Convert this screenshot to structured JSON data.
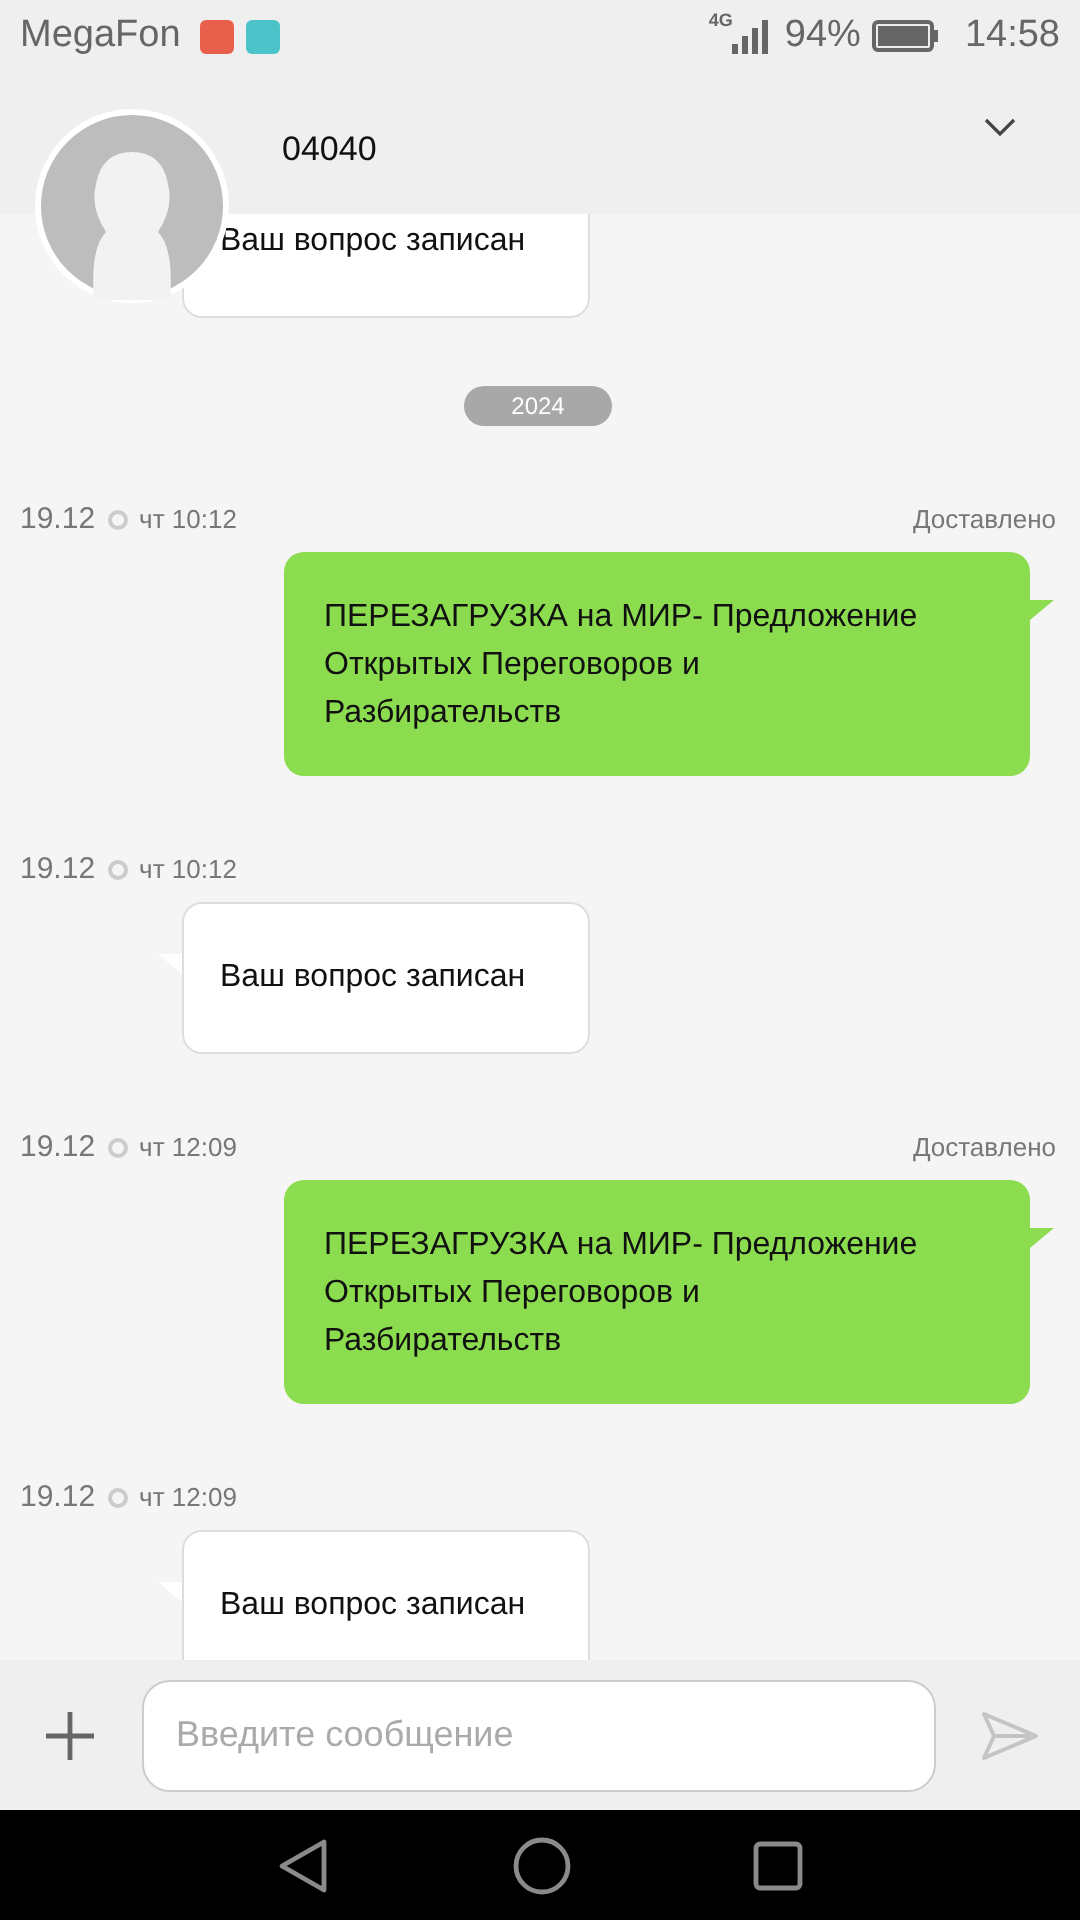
{
  "status_bar": {
    "carrier": "MegaFon",
    "network": "4G",
    "battery": "94%",
    "time": "14:58"
  },
  "header": {
    "contact": "04040"
  },
  "messages": [
    {
      "kind": "incoming",
      "text": "Ваш вопрос записан"
    },
    {
      "kind": "divider",
      "text": "2024"
    },
    {
      "kind": "outgoing",
      "date": "19.12",
      "time": "чт 10:12",
      "status": "Доставлено",
      "text": "ПЕРЕЗАГРУЗКА на МИР- Предложение Открытых Переговоров и Разбирательств"
    },
    {
      "kind": "incoming",
      "date": "19.12",
      "time": "чт 10:12",
      "text": "Ваш вопрос записан"
    },
    {
      "kind": "outgoing",
      "date": "19.12",
      "time": "чт 12:09",
      "status": "Доставлено",
      "text": "ПЕРЕЗАГРУЗКА на МИР- Предложение Открытых Переговоров и Разбирательств"
    },
    {
      "kind": "incoming",
      "date": "19.12",
      "time": "чт 12:09",
      "text": "Ваш вопрос записан"
    }
  ],
  "composer": {
    "placeholder": "Введите сообщение"
  }
}
